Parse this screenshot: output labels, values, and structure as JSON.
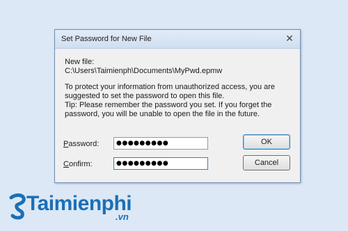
{
  "dialog": {
    "title": "Set Password for New File",
    "close_glyph": "✕",
    "new_file_label": "New file:",
    "file_path": "C:\\Users\\Taimienph\\Documents\\MyPwd.epmw",
    "info_line1": "To protect your information from unauthorized access, you are",
    "info_line2": "suggested to set the password to open this file.",
    "info_line3": "Tip: Please remember the password you set. If you forget the",
    "info_line4": "password, you will be unable to open the file in the future.",
    "password_label_hotkey": "P",
    "password_label_rest": "assword:",
    "password_value": "●●●●●●●●●",
    "confirm_label_hotkey": "C",
    "confirm_label_rest": "onfirm:",
    "confirm_value": "●●●●●●●●●",
    "ok_label": "OK",
    "cancel_label": "Cancel"
  },
  "watermark": {
    "brand": "Taimienphi",
    "tld": ".vn"
  },
  "colors": {
    "brand": "#1b6fb7",
    "background": "#dce8f5",
    "dialog_bg": "#f0f0f0"
  }
}
